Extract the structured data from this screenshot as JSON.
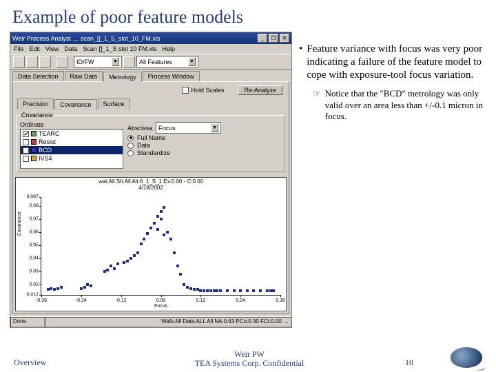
{
  "title": "Example of poor feature models",
  "bullets": {
    "main": "Feature variance with focus was very poor indicating a failure of the feature model to cope with exposure-tool focus variation.",
    "sub": "Notice that the \"BCD\" metrology was only valid over an area less than +/-0.1 micron in focus."
  },
  "footer": {
    "left": "Overview",
    "center1": "Weir PW",
    "center2": "TEA Systems Corp. Confidential",
    "page": "10"
  },
  "app": {
    "title": "Weir Process Analyst … scan_[]_1_S_slot_10_FM.xls",
    "menu": [
      "File",
      "Edit",
      "View",
      "Data",
      "Scan []_1_S slot 10 FM.xls",
      "Help"
    ],
    "comboMode": "ID/FW",
    "comboFilter": "All Features",
    "tabs_main": [
      "Data Selection",
      "Raw Data",
      "Metrology",
      "Process Window"
    ],
    "tabs_main_active": 2,
    "rean": {
      "chk": "Hold Scales",
      "btn": "Re-Analyze"
    },
    "tabs_sub": [
      "Precision",
      "Covariance",
      "Surface"
    ],
    "tabs_sub_active": 1,
    "ord_label": "Ordinate",
    "abs_label": "Abscissa",
    "abs_combo": "Focus",
    "features": [
      {
        "on": true,
        "color": "#65a15c",
        "name": "TEARC"
      },
      {
        "on": false,
        "color": "#c63a3a",
        "name": "Resist"
      },
      {
        "on": true,
        "color": "#2830c9",
        "name": "BCD",
        "sel": true
      },
      {
        "on": false,
        "color": "#d7a62b",
        "name": "IVS4"
      }
    ],
    "radios": [
      {
        "label": "Full Name",
        "on": true
      },
      {
        "label": "Data",
        "on": false
      },
      {
        "label": "Standardize",
        "on": false
      }
    ],
    "status_l": "Done.",
    "status_r": "Wafs:All  Data:ALL  All  NA:0.63  PCo:0.30  FCt:0.00 …"
  },
  "chart_data": {
    "type": "scatter",
    "title": "wat:All Sh:All Alt:6_1_S_1:Ex:0.00 - C:0.00",
    "subtitle": "4/18/2002",
    "xlabel": "Focus",
    "ylabel": "Covariance",
    "xlim": [
      -0.36,
      0.36
    ],
    "ylim": [
      0.012,
      0.087
    ],
    "xticks": [
      -0.36,
      -0.24,
      -0.12,
      0,
      0.12,
      0.24,
      0.36
    ],
    "yticks": [
      0.012,
      0.02,
      0.03,
      0.04,
      0.05,
      0.06,
      0.07,
      0.08,
      0.087
    ],
    "series": [
      {
        "name": "BCD",
        "color": "#1b2f8f",
        "points": [
          [
            -0.34,
            0.016
          ],
          [
            -0.33,
            0.017
          ],
          [
            -0.32,
            0.016
          ],
          [
            -0.31,
            0.017
          ],
          [
            -0.3,
            0.018
          ],
          [
            -0.24,
            0.017
          ],
          [
            -0.23,
            0.018
          ],
          [
            -0.22,
            0.02
          ],
          [
            -0.21,
            0.019
          ],
          [
            -0.17,
            0.03
          ],
          [
            -0.16,
            0.031
          ],
          [
            -0.15,
            0.034
          ],
          [
            -0.14,
            0.032
          ],
          [
            -0.13,
            0.036
          ],
          [
            -0.11,
            0.037
          ],
          [
            -0.1,
            0.038
          ],
          [
            -0.09,
            0.04
          ],
          [
            -0.08,
            0.042
          ],
          [
            -0.07,
            0.044
          ],
          [
            -0.06,
            0.051
          ],
          [
            -0.05,
            0.055
          ],
          [
            -0.04,
            0.059
          ],
          [
            -0.03,
            0.063
          ],
          [
            -0.02,
            0.067
          ],
          [
            -0.01,
            0.072
          ],
          [
            -0.01,
            0.062
          ],
          [
            0.0,
            0.076
          ],
          [
            0.0,
            0.07
          ],
          [
            0.01,
            0.079
          ],
          [
            0.01,
            0.058
          ],
          [
            0.02,
            0.06
          ],
          [
            0.03,
            0.055
          ],
          [
            0.04,
            0.044
          ],
          [
            0.05,
            0.034
          ],
          [
            0.06,
            0.028
          ],
          [
            0.07,
            0.02
          ],
          [
            0.08,
            0.018
          ],
          [
            0.09,
            0.017
          ],
          [
            0.1,
            0.016
          ],
          [
            0.11,
            0.016
          ],
          [
            0.12,
            0.015
          ],
          [
            0.13,
            0.015
          ],
          [
            0.14,
            0.015
          ],
          [
            0.15,
            0.015
          ],
          [
            0.16,
            0.015
          ],
          [
            0.17,
            0.015
          ],
          [
            0.18,
            0.015
          ],
          [
            0.2,
            0.015
          ],
          [
            0.22,
            0.015
          ],
          [
            0.24,
            0.015
          ],
          [
            0.26,
            0.015
          ],
          [
            0.28,
            0.015
          ],
          [
            0.3,
            0.015
          ],
          [
            0.32,
            0.015
          ],
          [
            0.33,
            0.015
          ],
          [
            0.34,
            0.015
          ]
        ]
      }
    ]
  }
}
